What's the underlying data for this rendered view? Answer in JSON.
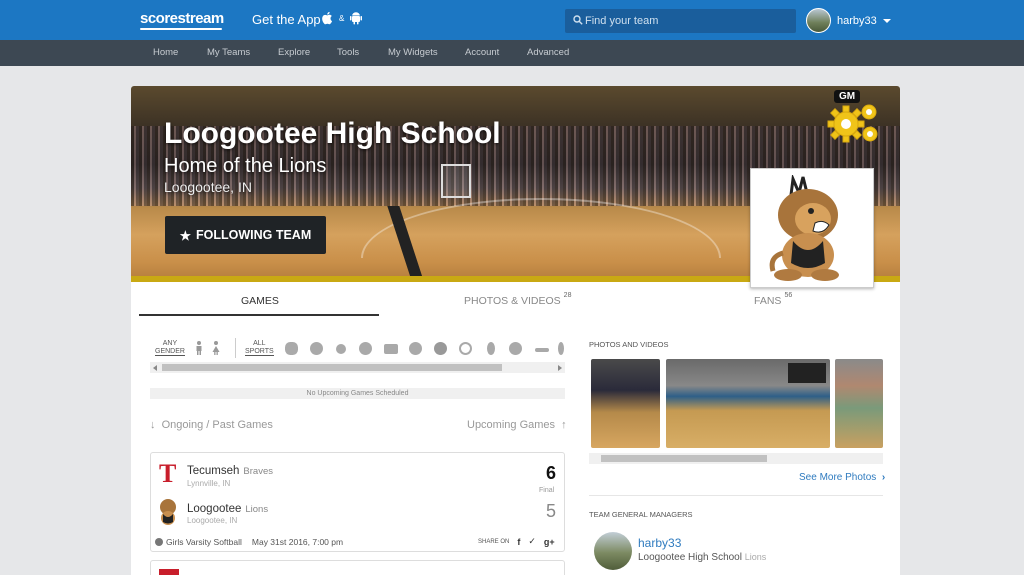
{
  "header": {
    "logo": "scorestream",
    "get_app": "Get the App",
    "amp": "&",
    "search_placeholder": "Find your team",
    "username": "harby33"
  },
  "nav": {
    "items": [
      "Home",
      "My Teams",
      "Explore",
      "Tools",
      "My Widgets",
      "Account",
      "Advanced"
    ]
  },
  "school": {
    "name": "Loogootee High School",
    "subtitle": "Home of the Lions",
    "location": "Loogootee, IN",
    "follow_label": "FOLLOWING TEAM",
    "gm_tag": "GM"
  },
  "tabs": {
    "games": "GAMES",
    "photos": "PHOTOS & VIDEOS",
    "photos_count": "28",
    "fans": "FANS",
    "fans_count": "56"
  },
  "filters": {
    "gender_line1": "ANY",
    "gender_line2": "GENDER",
    "sports_line1": "ALL",
    "sports_line2": "SPORTS"
  },
  "games": {
    "no_upcoming": "No Upcoming Games Scheduled",
    "ongoing_label": "Ongoing / Past Games",
    "upcoming_label": "Upcoming Games",
    "game1": {
      "home": {
        "name": "Tecumseh",
        "mascot": "Braves",
        "city": "Lynnville, IN",
        "score": "6"
      },
      "away": {
        "name": "Loogootee",
        "mascot": "Lions",
        "city": "Loogootee, IN",
        "score": "5"
      },
      "status": "Final",
      "sport": "Girls Varsity Softball",
      "datetime": "May 31st 2016, 7:00 pm",
      "share_label": "SHARE ON"
    }
  },
  "right": {
    "photos_title": "PHOTOS AND VIDEOS",
    "see_more": "See More Photos",
    "managers_title": "TEAM GENERAL MANAGERS",
    "manager": {
      "name": "harby33",
      "team": "Loogootee High School",
      "mascot": "Lions"
    }
  },
  "colors": {
    "topbar": "#1c77c3",
    "navbar": "#3d4853",
    "link": "#2f7bbf",
    "gold": "#c9a913"
  }
}
